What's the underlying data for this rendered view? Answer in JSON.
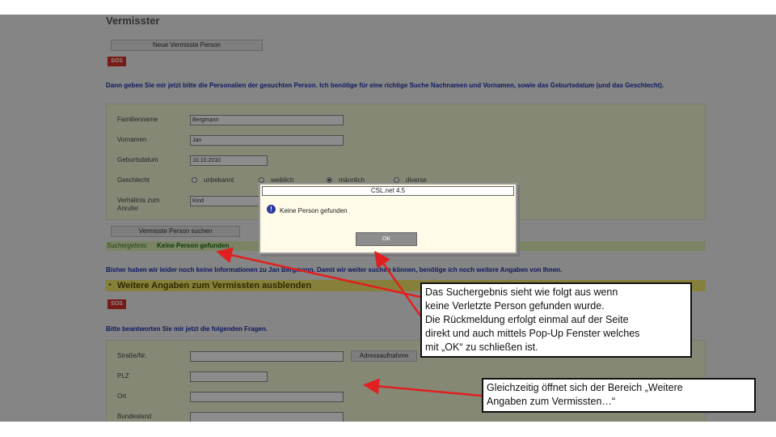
{
  "page": {
    "title": "Vermisster",
    "new_person_button": "Neue Vermisste Person",
    "sos_label": "SOS",
    "intro_text": "Dann geben Sie mir jetzt bitte die Personalien der gesuchten Person. Ich benötige für eine richtige Suche Nachnamen und Vornamen, sowie das Geburtsdatum (und das Geschlecht).",
    "form": {
      "familienname_label": "Familienname",
      "familienname_value": "Bergmann",
      "vorname_label": "Vornamen",
      "vorname_value": "Jan",
      "geburtsdatum_label": "Geburtsdatum",
      "geburtsdatum_value": "10.10.2010",
      "geschlecht_label": "Geschlecht",
      "gender_options": [
        "unbekannt",
        "weiblich",
        "männlich",
        "diverse"
      ],
      "gender_selected": "männlich",
      "verhaeltnis_label": "Verhältnis zum Anrufer",
      "verhaeltnis_value": "Kind"
    },
    "search_button": "Vermisste Person suchen",
    "result_prefix": "Suchergebnis:",
    "result_value": "Keine Person gefunden",
    "info_text": "Bisher haben wir leider noch keine Informationen zu Jan Bergmann. Damit wir weiter suchen können, benötige ich noch weitere Angaben von Ihnen.",
    "toggle_section": "Weitere Angaben zum Vermissten ausblenden",
    "questions_text": "Bitte beantworten Sie mir jetzt die folgenden Fragen.",
    "address": {
      "strasse_label": "Straße/Nr.",
      "plz_label": "PLZ",
      "ort_label": "Ort",
      "bundesland_label": "Bundesland",
      "address_button": "Adressaufnahme"
    }
  },
  "dialog": {
    "title": "CSL.net 4.5",
    "icon": "!",
    "message": "Keine Person gefunden",
    "ok_label": "OK"
  },
  "annotations": {
    "callout_1": "Das Suchergebnis sieht wie folgt aus wenn\nkeine Verletzte Person gefunden wurde.\nDie Rückmeldung erfolgt einmal auf der Seite\ndirekt und auch mittels Pop-Up Fenster welches\nmit „OK“ zu schließen ist.",
    "callout_2": "Gleichzeitig öffnet sich der Bereich „Weitere\nAngaben zum Vermissten…“",
    "arrow_color": "#e02020"
  }
}
